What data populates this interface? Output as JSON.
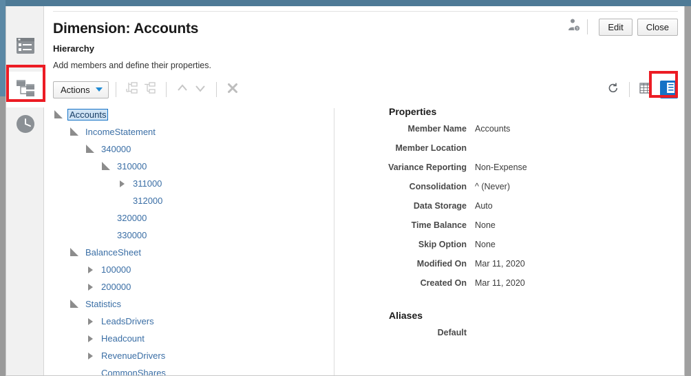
{
  "window": {
    "title": "Dimension: Accounts"
  },
  "header": {
    "title": "Dimension: Accounts",
    "section_title": "Hierarchy",
    "description": "Add members and define their properties.",
    "user_icon": "user-help-icon",
    "edit_label": "Edit",
    "close_label": "Close"
  },
  "rail": {
    "items": [
      {
        "icon": "dimension-details-icon",
        "name": "sidebar-item-details",
        "active": false
      },
      {
        "icon": "hierarchy-tree-icon",
        "name": "sidebar-item-hierarchy",
        "active": true
      },
      {
        "icon": "history-clock-icon",
        "name": "sidebar-item-history",
        "active": false
      }
    ]
  },
  "toolbar": {
    "actions_label": "Actions",
    "caret_icon": "chevron-down-icon",
    "buttons": [
      {
        "name": "add-child-button",
        "icon": "add-child-icon",
        "disabled": true
      },
      {
        "name": "add-sibling-button",
        "icon": "add-sibling-icon",
        "disabled": true
      },
      {
        "name": "move-up-button",
        "icon": "chevron-up-icon",
        "disabled": true
      },
      {
        "name": "move-down-button",
        "icon": "chevron-down-icon",
        "disabled": true
      },
      {
        "name": "delete-button",
        "icon": "close-x-icon",
        "disabled": true
      }
    ],
    "right_buttons": [
      {
        "name": "refresh-button",
        "icon": "refresh-icon",
        "active": false
      },
      {
        "name": "grid-view-button",
        "icon": "grid-icon",
        "active": false
      },
      {
        "name": "properties-panel-toggle",
        "icon": "properties-panel-icon",
        "active": true
      }
    ]
  },
  "tree": {
    "nodes": [
      {
        "label": "Accounts",
        "depth": 0,
        "state": "expanded",
        "selected": true
      },
      {
        "label": "IncomeStatement",
        "depth": 1,
        "state": "expanded",
        "selected": false
      },
      {
        "label": "340000",
        "depth": 2,
        "state": "expanded",
        "selected": false
      },
      {
        "label": "310000",
        "depth": 3,
        "state": "expanded",
        "selected": false
      },
      {
        "label": "311000",
        "depth": 4,
        "state": "collapsed",
        "selected": false
      },
      {
        "label": "312000",
        "depth": 4,
        "state": "leaf",
        "selected": false
      },
      {
        "label": "320000",
        "depth": 3,
        "state": "leaf",
        "selected": false
      },
      {
        "label": "330000",
        "depth": 3,
        "state": "leaf",
        "selected": false
      },
      {
        "label": "BalanceSheet",
        "depth": 1,
        "state": "expanded",
        "selected": false
      },
      {
        "label": "100000",
        "depth": 2,
        "state": "collapsed",
        "selected": false
      },
      {
        "label": "200000",
        "depth": 2,
        "state": "collapsed",
        "selected": false
      },
      {
        "label": "Statistics",
        "depth": 1,
        "state": "expanded",
        "selected": false
      },
      {
        "label": "LeadsDrivers",
        "depth": 2,
        "state": "collapsed",
        "selected": false
      },
      {
        "label": "Headcount",
        "depth": 2,
        "state": "collapsed",
        "selected": false
      },
      {
        "label": "RevenueDrivers",
        "depth": 2,
        "state": "collapsed",
        "selected": false
      },
      {
        "label": "CommonShares",
        "depth": 2,
        "state": "leaf",
        "selected": false
      }
    ]
  },
  "properties": {
    "heading": "Properties",
    "rows": [
      {
        "label": "Member Name",
        "value": "Accounts"
      },
      {
        "label": "Member Location",
        "value": ""
      },
      {
        "label": "Variance Reporting",
        "value": "Non-Expense"
      },
      {
        "label": "Consolidation",
        "value": "^ (Never)"
      },
      {
        "label": "Data Storage",
        "value": "Auto"
      },
      {
        "label": "Time Balance",
        "value": "None"
      },
      {
        "label": "Skip Option",
        "value": "None"
      },
      {
        "label": "Modified On",
        "value": "Mar 11, 2020"
      },
      {
        "label": "Created On",
        "value": "Mar 11, 2020"
      }
    ]
  },
  "aliases": {
    "heading": "Aliases",
    "rows": [
      {
        "label": "Default",
        "value": ""
      }
    ]
  },
  "colors": {
    "accent_blue": "#1572c6",
    "link_blue": "#3a6ea5",
    "annotation_red": "#ec1c24",
    "chrome_blue": "#4e7a96"
  }
}
